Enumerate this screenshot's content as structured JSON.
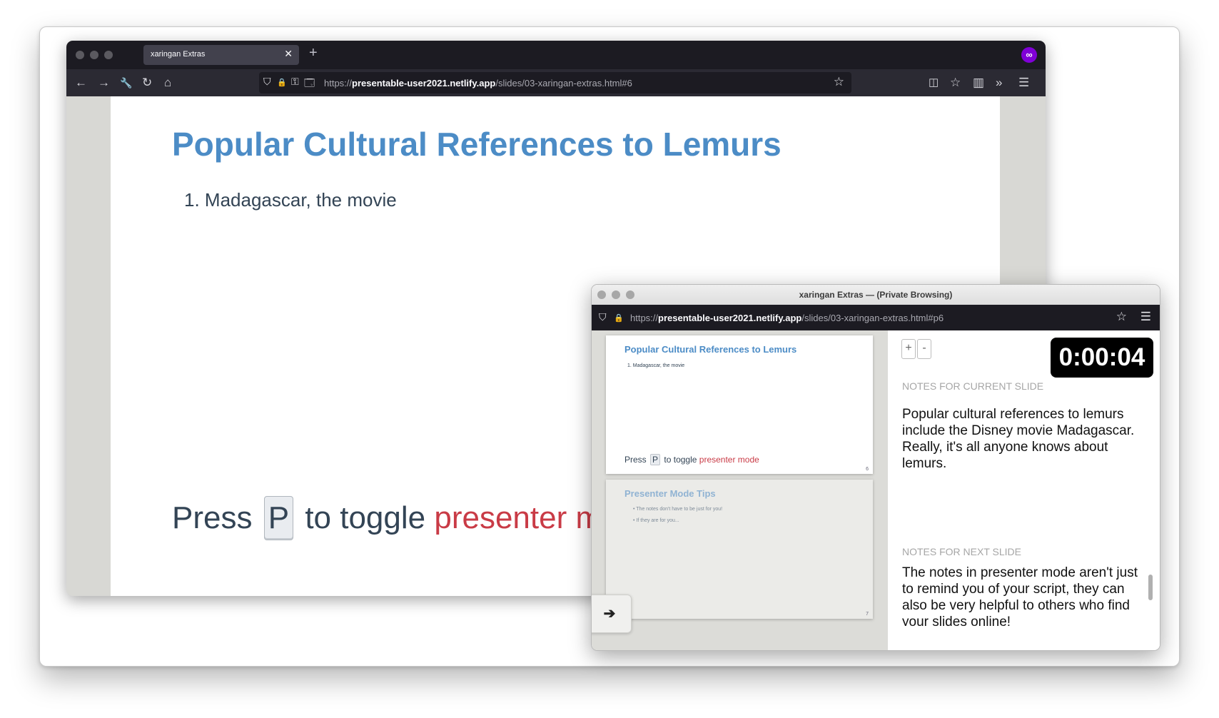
{
  "main_browser": {
    "tab_title": "xaringan Extras",
    "tab_close": "✕",
    "new_tab": "+",
    "extension_badge": "∞",
    "url_scheme": "https://",
    "url_host": "presentable-user2021.netlify.app",
    "url_path": "/slides/03-xaringan-extras.html#6",
    "icons": {
      "back": "←",
      "forward": "→",
      "tools": "🔧",
      "reload": "↻",
      "home": "⌂",
      "shield": "⛉",
      "lock": "🔒",
      "permissions": "⚿",
      "page": "🗔",
      "star": "☆",
      "pocket": "◫",
      "library": "☆",
      "sidebar": "▥",
      "overflow": "»",
      "menu": "☰"
    }
  },
  "slide": {
    "title": "Popular Cultural References to Lemurs",
    "list_item": "1. Madagascar, the movie",
    "press_prefix": "Press",
    "press_key": "P",
    "press_middle": "to toggle",
    "press_highlight": "presenter mo"
  },
  "presenter_window": {
    "title": "xaringan Extras — (Private Browsing)",
    "url_scheme": "https://",
    "url_host": "presentable-user2021.netlify.app",
    "url_path": "/slides/03-xaringan-extras.html#p6",
    "current_thumb": {
      "title": "Popular Cultural References to Lemurs",
      "item": "1. Madagascar, the movie",
      "press_prefix": "Press",
      "press_key": "P",
      "press_middle": "to toggle",
      "press_highlight": "presenter mode",
      "number": "6"
    },
    "next_thumb": {
      "title": "Presenter Mode Tips",
      "bullets": [
        "• The notes don't have to be just for you!",
        "• If they are for you..."
      ],
      "number": "7"
    },
    "next_button": "➔",
    "zoom_in": "+",
    "zoom_out": "-",
    "timer": "0:00:04",
    "notes_current_label": "NOTES FOR CURRENT SLIDE",
    "notes_current": "Popular cultural references to lemurs include the Disney movie Madagascar. Really, it's all anyone knows about lemurs.",
    "notes_next_label": "NOTES FOR NEXT SLIDE",
    "notes_next": "The notes in presenter mode aren't just to remind you of your script, they can also be very helpful to others who find your slides online!"
  }
}
